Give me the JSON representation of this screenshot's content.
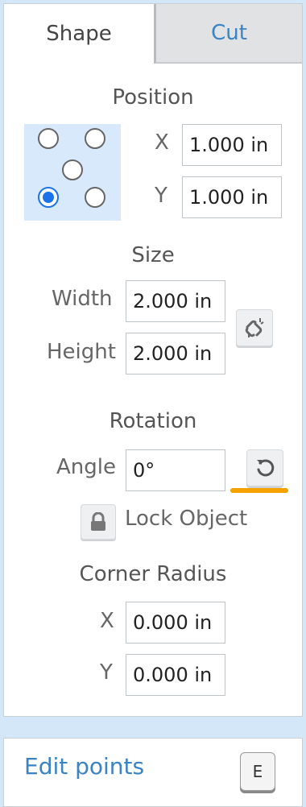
{
  "tabs": [
    {
      "label": "Shape",
      "active": true
    },
    {
      "label": "Cut",
      "active": false
    }
  ],
  "position": {
    "title": "Position",
    "anchors": [
      {
        "id": "top-left",
        "selected": false
      },
      {
        "id": "top-right",
        "selected": false
      },
      {
        "id": "center",
        "selected": false
      },
      {
        "id": "bottom-left",
        "selected": true
      },
      {
        "id": "bottom-right",
        "selected": false
      }
    ],
    "x_label": "X",
    "x_value": "1.000 in",
    "y_label": "Y",
    "y_value": "1.000 in"
  },
  "size": {
    "title": "Size",
    "width_label": "Width",
    "width_value": "2.000 in",
    "height_label": "Height",
    "height_value": "2.000 in",
    "link_icon": "unlink-icon"
  },
  "rotation": {
    "title": "Rotation",
    "angle_label": "Angle",
    "angle_value": "0°",
    "reset_icon": "rotate-reset-icon"
  },
  "lock": {
    "label": "Lock Object",
    "icon": "lock-icon"
  },
  "corner_radius": {
    "title": "Corner Radius",
    "x_label": "X",
    "x_value": "0.000 in",
    "y_label": "Y",
    "y_value": "0.000 in"
  },
  "edit_points": {
    "label": "Edit points",
    "shortcut": "E"
  },
  "colors": {
    "accent": "#1a73e8",
    "link": "#3a83c4",
    "highlight": "#f5a100",
    "background": "#d3e7f8"
  }
}
